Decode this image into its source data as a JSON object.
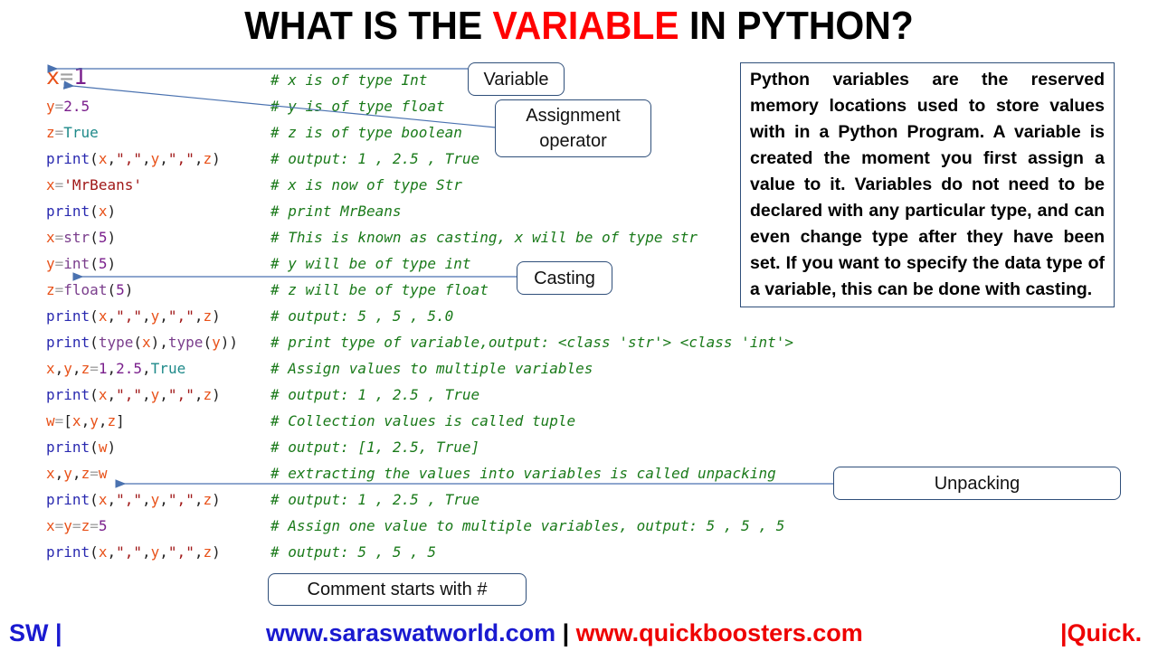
{
  "title": {
    "prefix": "WHAT IS THE ",
    "accent": "VARIABLE",
    "suffix": " IN PYTHON?"
  },
  "code_lines": [
    {
      "tokens": [
        [
          "x",
          "var"
        ],
        [
          "=",
          "op"
        ],
        [
          "1",
          "num"
        ]
      ],
      "comment": "# x is of type Int",
      "big": true
    },
    {
      "tokens": [
        [
          "y",
          "var"
        ],
        [
          "=",
          "op"
        ],
        [
          "2.5",
          "num"
        ]
      ],
      "comment": "# y is of type float"
    },
    {
      "tokens": [
        [
          "z",
          "var"
        ],
        [
          "=",
          "op"
        ],
        [
          "True",
          "bool"
        ]
      ],
      "comment": "# z is of type boolean"
    },
    {
      "tokens": [
        [
          "print",
          "kw"
        ],
        [
          "(",
          "punc"
        ],
        [
          "x",
          "var"
        ],
        [
          ",",
          "punc"
        ],
        [
          "\",\"",
          "strq"
        ],
        [
          ",",
          "punc"
        ],
        [
          "y",
          "var"
        ],
        [
          ",",
          "punc"
        ],
        [
          "\",\"",
          "strq"
        ],
        [
          ",",
          "punc"
        ],
        [
          "z",
          "var"
        ],
        [
          ")",
          "punc"
        ]
      ],
      "comment": "# output: 1 , 2.5 , True"
    },
    {
      "tokens": [
        [
          "x",
          "var"
        ],
        [
          "=",
          "op"
        ],
        [
          "'MrBeans'",
          "str"
        ]
      ],
      "comment": "# x is now of type Str"
    },
    {
      "tokens": [
        [
          "print",
          "kw"
        ],
        [
          "(",
          "punc"
        ],
        [
          "x",
          "var"
        ],
        [
          ")",
          "punc"
        ]
      ],
      "comment": "# print MrBeans"
    },
    {
      "tokens": [
        [
          "x",
          "var"
        ],
        [
          "=",
          "op"
        ],
        [
          "str",
          "fn"
        ],
        [
          "(",
          "punc"
        ],
        [
          "5",
          "num"
        ],
        [
          ")",
          "punc"
        ]
      ],
      "comment": "# This is known as casting, x will be of type str"
    },
    {
      "tokens": [
        [
          "y",
          "var"
        ],
        [
          "=",
          "op"
        ],
        [
          "int",
          "fn"
        ],
        [
          "(",
          "punc"
        ],
        [
          "5",
          "num"
        ],
        [
          ")",
          "punc"
        ]
      ],
      "comment": "# y will be of type int"
    },
    {
      "tokens": [
        [
          "z",
          "var"
        ],
        [
          "=",
          "op"
        ],
        [
          "float",
          "fn"
        ],
        [
          "(",
          "punc"
        ],
        [
          "5",
          "num"
        ],
        [
          ")",
          "punc"
        ]
      ],
      "comment": "# z will be of type float"
    },
    {
      "tokens": [
        [
          "print",
          "kw"
        ],
        [
          "(",
          "punc"
        ],
        [
          "x",
          "var"
        ],
        [
          ",",
          "punc"
        ],
        [
          "\",\"",
          "strq"
        ],
        [
          ",",
          "punc"
        ],
        [
          "y",
          "var"
        ],
        [
          ",",
          "punc"
        ],
        [
          "\",\"",
          "strq"
        ],
        [
          ",",
          "punc"
        ],
        [
          "z",
          "var"
        ],
        [
          ")",
          "punc"
        ]
      ],
      "comment": "# output: 5 , 5 , 5.0"
    },
    {
      "tokens": [
        [
          "print",
          "kw"
        ],
        [
          "(",
          "punc"
        ],
        [
          "type",
          "fn"
        ],
        [
          "(",
          "punc"
        ],
        [
          "x",
          "var"
        ],
        [
          ")",
          "punc"
        ],
        [
          ",",
          "punc"
        ],
        [
          "type",
          "fn"
        ],
        [
          "(",
          "punc"
        ],
        [
          "y",
          "var"
        ],
        [
          "))",
          "punc"
        ]
      ],
      "comment": "# print type of variable,output: <class 'str'> <class 'int'>"
    },
    {
      "tokens": [
        [
          "x",
          "var"
        ],
        [
          ",",
          "punc"
        ],
        [
          "y",
          "var"
        ],
        [
          ",",
          "punc"
        ],
        [
          "z",
          "var"
        ],
        [
          "=",
          "op"
        ],
        [
          "1",
          "num"
        ],
        [
          ",",
          "punc"
        ],
        [
          "2.5",
          "num"
        ],
        [
          ",",
          "punc"
        ],
        [
          "True",
          "bool"
        ]
      ],
      "comment": "# Assign values to multiple variables"
    },
    {
      "tokens": [
        [
          "print",
          "kw"
        ],
        [
          "(",
          "punc"
        ],
        [
          "x",
          "var"
        ],
        [
          ",",
          "punc"
        ],
        [
          "\",\"",
          "strq"
        ],
        [
          ",",
          "punc"
        ],
        [
          "y",
          "var"
        ],
        [
          ",",
          "punc"
        ],
        [
          "\",\"",
          "strq"
        ],
        [
          ",",
          "punc"
        ],
        [
          "z",
          "var"
        ],
        [
          ")",
          "punc"
        ]
      ],
      "comment": "# output: 1 , 2.5 , True"
    },
    {
      "tokens": [
        [
          "w",
          "var"
        ],
        [
          "=",
          "op"
        ],
        [
          "[",
          "punc"
        ],
        [
          "x",
          "var"
        ],
        [
          ",",
          "punc"
        ],
        [
          "y",
          "var"
        ],
        [
          ",",
          "punc"
        ],
        [
          "z",
          "var"
        ],
        [
          "]",
          "punc"
        ]
      ],
      "comment": "# Collection values is called tuple"
    },
    {
      "tokens": [
        [
          "print",
          "kw"
        ],
        [
          "(",
          "punc"
        ],
        [
          "w",
          "var"
        ],
        [
          ")",
          "punc"
        ]
      ],
      "comment": "# output: [1, 2.5, True]"
    },
    {
      "tokens": [
        [
          "x",
          "var"
        ],
        [
          ",",
          "punc"
        ],
        [
          "y",
          "var"
        ],
        [
          ",",
          "punc"
        ],
        [
          "z",
          "var"
        ],
        [
          "=",
          "op"
        ],
        [
          "w",
          "var"
        ]
      ],
      "comment": "# extracting the values into variables is called unpacking"
    },
    {
      "tokens": [
        [
          "print",
          "kw"
        ],
        [
          "(",
          "punc"
        ],
        [
          "x",
          "var"
        ],
        [
          ",",
          "punc"
        ],
        [
          "\",\"",
          "strq"
        ],
        [
          ",",
          "punc"
        ],
        [
          "y",
          "var"
        ],
        [
          ",",
          "punc"
        ],
        [
          "\",\"",
          "strq"
        ],
        [
          ",",
          "punc"
        ],
        [
          "z",
          "var"
        ],
        [
          ")",
          "punc"
        ]
      ],
      "comment": "# output: 1 , 2.5 , True"
    },
    {
      "tokens": [
        [
          "x",
          "var"
        ],
        [
          "=",
          "op"
        ],
        [
          "y",
          "var"
        ],
        [
          "=",
          "op"
        ],
        [
          "z",
          "var"
        ],
        [
          "=",
          "op"
        ],
        [
          "5",
          "num"
        ]
      ],
      "comment": "# Assign one value to multiple variables, output: 5 , 5 , 5"
    },
    {
      "tokens": [
        [
          "print",
          "kw"
        ],
        [
          "(",
          "punc"
        ],
        [
          "x",
          "var"
        ],
        [
          ",",
          "punc"
        ],
        [
          "\",\"",
          "strq"
        ],
        [
          ",",
          "punc"
        ],
        [
          "y",
          "var"
        ],
        [
          ",",
          "punc"
        ],
        [
          "\",\"",
          "strq"
        ],
        [
          ",",
          "punc"
        ],
        [
          "z",
          "var"
        ],
        [
          ")",
          "punc"
        ]
      ],
      "comment": "# output: 5 , 5 , 5"
    }
  ],
  "callouts": {
    "variable": "Variable",
    "assignment_line1": "Assignment",
    "assignment_line2": "operator",
    "casting": "Casting",
    "unpacking": "Unpacking",
    "comment": "Comment starts with #"
  },
  "info_box": "Python variables are the reserved memory locations used to store values with in a Python Program. A variable is created the moment you first assign a value to it. Variables do not need to be declared with any particular type, and can even change type after they have been set. If you want to specify the data type of a variable, this can be done with casting.",
  "footer": {
    "left": "SW |",
    "site1": "www.saraswatworld.com",
    "separator": " | ",
    "site2": "www.quickboosters.com",
    "right": "|Quick."
  },
  "colors": {
    "title_accent": "#ff0000",
    "comment": "#1a7a1a",
    "footer_blue": "#1a1ad0",
    "footer_red": "#ee0000",
    "arrow": "#4a72b0"
  }
}
